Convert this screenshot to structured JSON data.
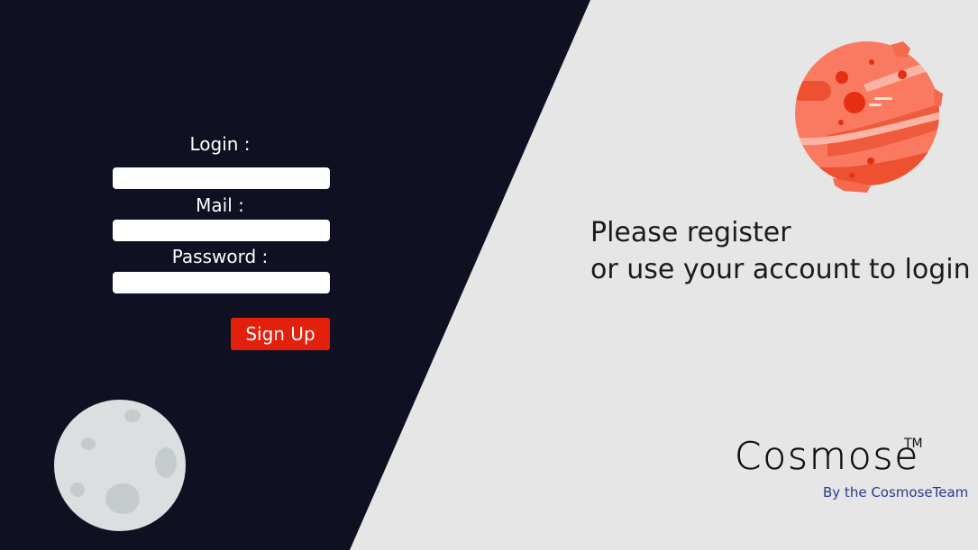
{
  "form": {
    "login_label": "Login :",
    "login_value": "",
    "mail_label": "Mail :",
    "mail_value": "",
    "password_label": "Password :",
    "password_value": "",
    "signup_label": "Sign Up"
  },
  "tagline": {
    "line1": "Please register",
    "line2": "or use your account to login"
  },
  "brand": {
    "name": "Cosmose",
    "trademark": "TM",
    "byline": "By the CosmoseTeam"
  },
  "colors": {
    "dark_panel": "#0f1122",
    "light_panel": "#e6e6e6",
    "accent": "#e2200b",
    "byline": "#2b3a8f",
    "planet": "#f97a60",
    "moon": "#dcdfe0"
  },
  "icons": {
    "planet": "red-planet-icon",
    "moon": "moon-icon"
  }
}
